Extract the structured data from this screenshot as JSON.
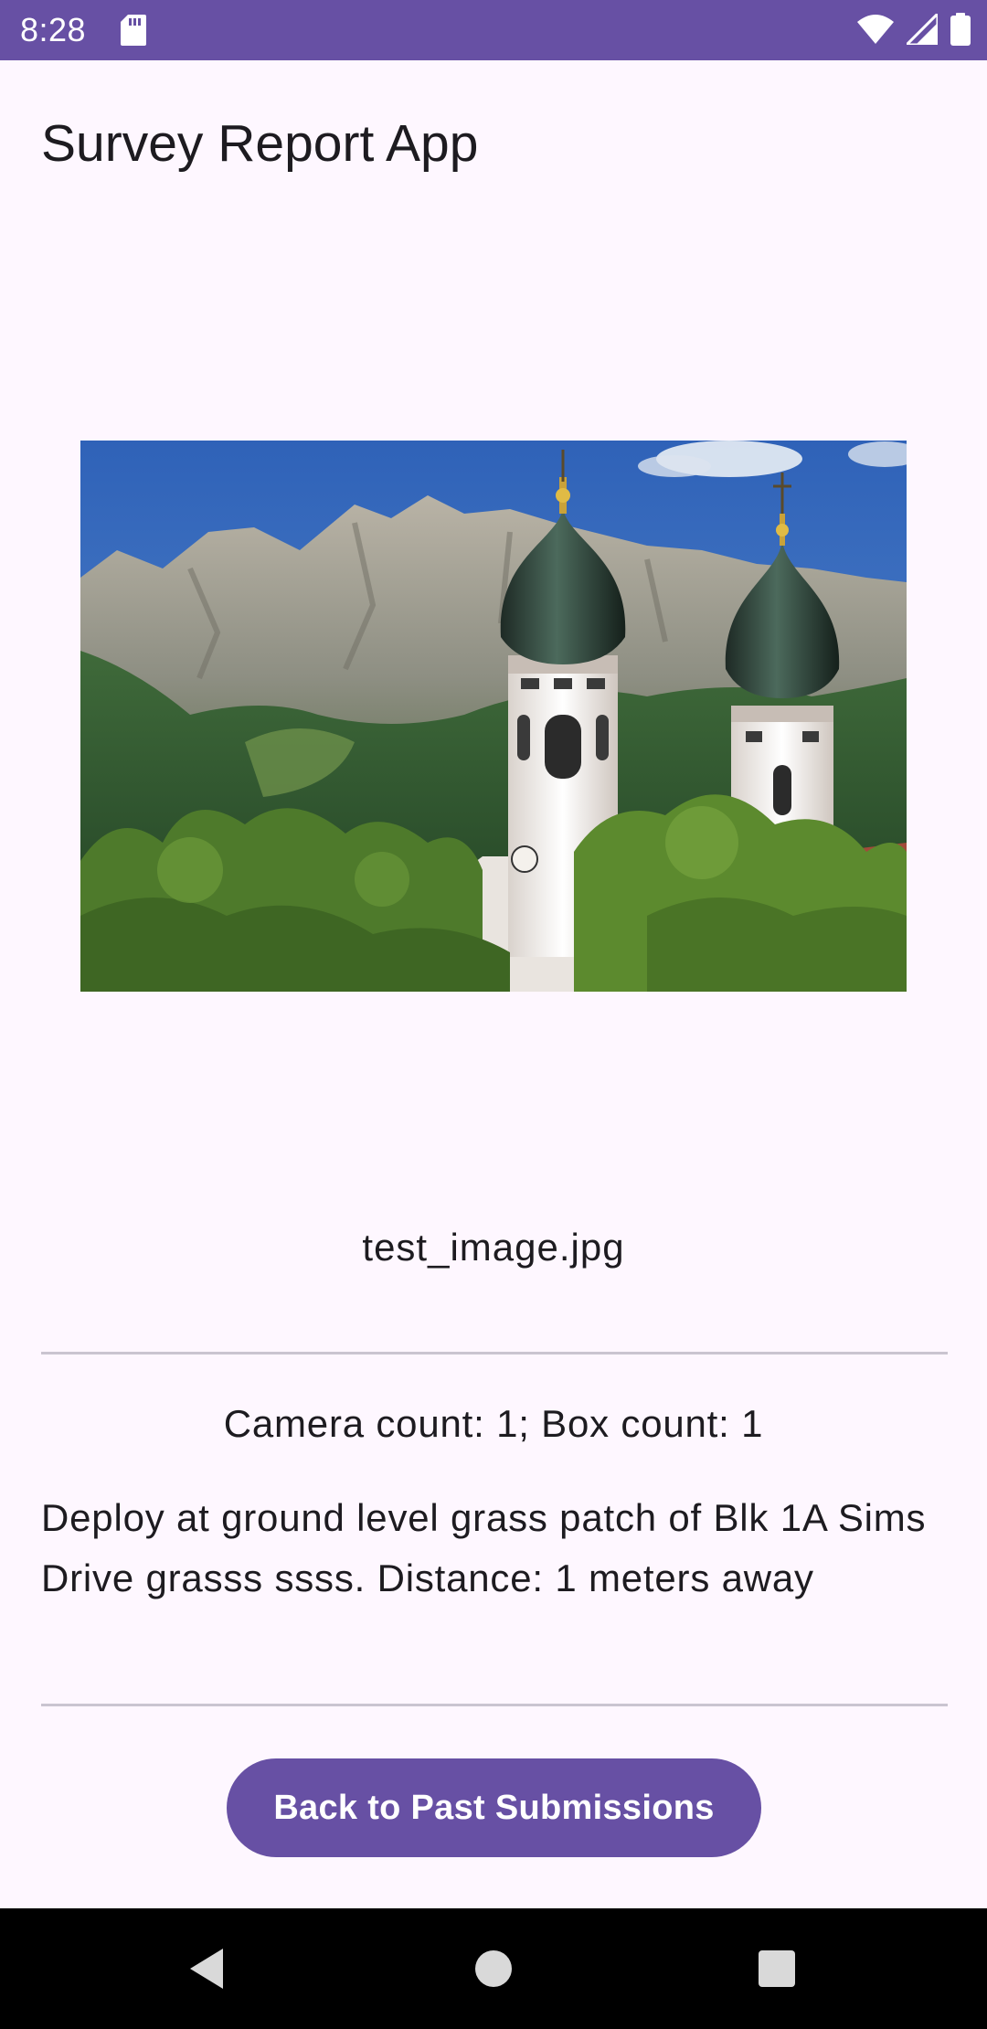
{
  "status_bar": {
    "time": "8:28",
    "icons": [
      "sd-card-icon",
      "wifi-icon",
      "signal-icon",
      "battery-icon"
    ]
  },
  "app": {
    "title": "Survey Report App"
  },
  "report": {
    "image_alt": "photo of onion-domed church towers in front of a mountain",
    "filename": "test_image.jpg",
    "counts": "Camera count: 1; Box count: 1",
    "description": "Deploy at ground level grass patch of Blk 1A Sims Drive grasss ssss. Distance: 1 meters away"
  },
  "actions": {
    "back_label": "Back to Past Submissions"
  },
  "nav_bar": {
    "buttons": [
      "back-icon",
      "home-icon",
      "recents-icon"
    ]
  },
  "colors": {
    "primary": "#6750A4",
    "background": "#FEF7FF",
    "text": "#1D1B20",
    "divider": "#CAC4D0"
  }
}
